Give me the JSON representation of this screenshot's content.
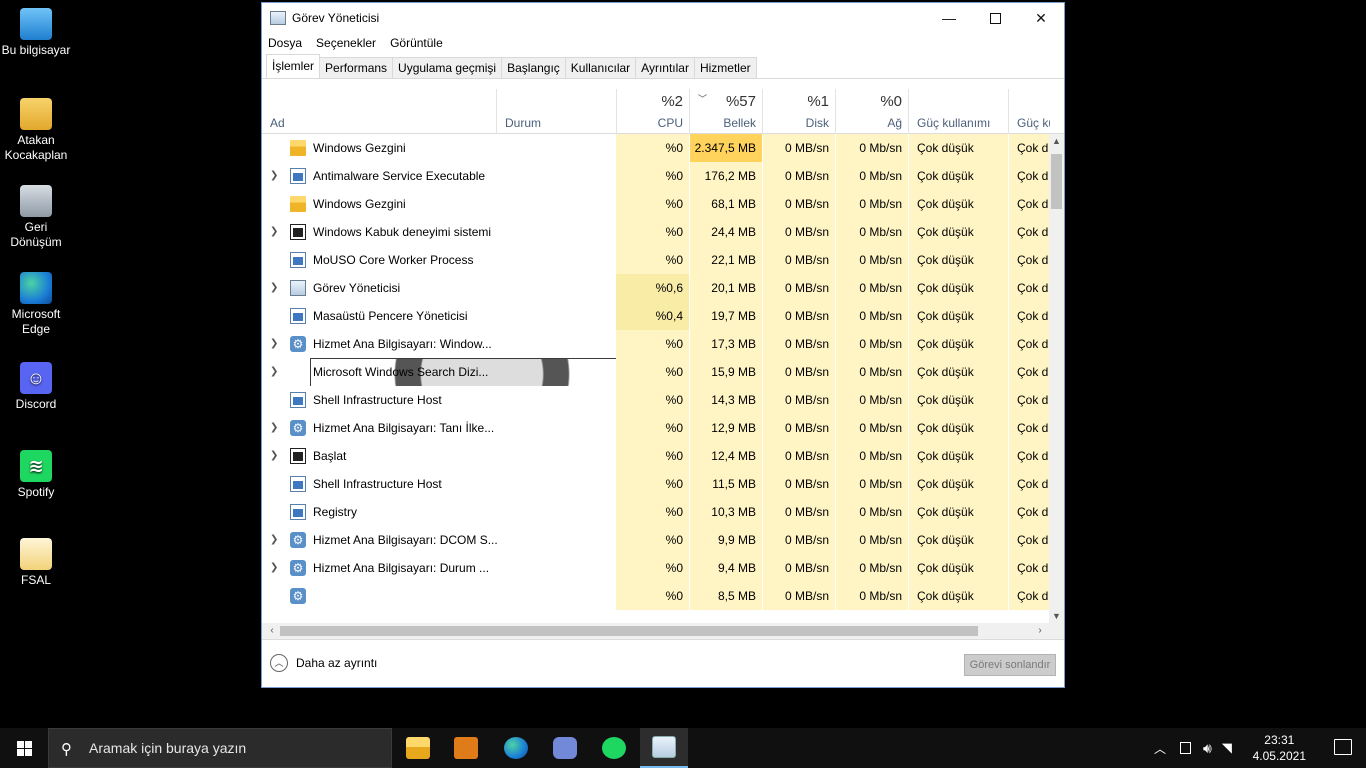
{
  "desktop": {
    "icons": [
      {
        "label": "Bu bilgisayar",
        "icon": "this-pc-icon"
      },
      {
        "label": "Atakan Kocakaplan",
        "icon": "user-folder-icon"
      },
      {
        "label": "Geri Dönüşüm",
        "icon": "recycle-bin-icon"
      },
      {
        "label": "Microsoft Edge",
        "icon": "edge-icon"
      },
      {
        "label": "Discord",
        "icon": "discord-icon"
      },
      {
        "label": "Spotify",
        "icon": "spotify-icon"
      },
      {
        "label": "FSAL",
        "icon": "file-icon"
      }
    ]
  },
  "window": {
    "title": "Görev Yöneticisi",
    "menu": [
      "Dosya",
      "Seçenekler",
      "Görüntüle"
    ],
    "tabs": [
      "İşlemler",
      "Performans",
      "Uygulama geçmişi",
      "Başlangıç",
      "Kullanıcılar",
      "Ayrıntılar",
      "Hizmetler"
    ],
    "active_tab": "İşlemler",
    "columns": {
      "name": "Ad",
      "status": "Durum",
      "cpu_pct": "%2",
      "cpu": "CPU",
      "mem_pct": "%57",
      "mem": "Bellek",
      "disk_pct": "%1",
      "disk": "Disk",
      "net_pct": "%0",
      "net": "Ağ",
      "power": "Güç kullanımı",
      "power_trend": "Güç kulla"
    },
    "rows": [
      {
        "name": "Windows Gezgini",
        "icon": "folder",
        "expand": false,
        "cpu": "%0",
        "mem": "2.347,5 MB",
        "disk": "0 MB/sn",
        "net": "0 Mb/sn",
        "power": "Çok düşük",
        "power2": "Çok dü"
      },
      {
        "name": "Antimalware Service Executable",
        "icon": "blue",
        "expand": true,
        "cpu": "%0",
        "mem": "176,2 MB",
        "disk": "0 MB/sn",
        "net": "0 Mb/sn",
        "power": "Çok düşük",
        "power2": "Çok dü"
      },
      {
        "name": "Windows Gezgini",
        "icon": "folder",
        "expand": false,
        "cpu": "%0",
        "mem": "68,1 MB",
        "disk": "0 MB/sn",
        "net": "0 Mb/sn",
        "power": "Çok düşük",
        "power2": "Çok dü"
      },
      {
        "name": "Windows Kabuk deneyimi sistemi",
        "icon": "dark",
        "expand": true,
        "cpu": "%0",
        "mem": "24,4 MB",
        "disk": "0 MB/sn",
        "net": "0 Mb/sn",
        "power": "Çok düşük",
        "power2": "Çok dü"
      },
      {
        "name": "MoUSO Core Worker Process",
        "icon": "blue",
        "expand": false,
        "cpu": "%0",
        "mem": "22,1 MB",
        "disk": "0 MB/sn",
        "net": "0 Mb/sn",
        "power": "Çok düşük",
        "power2": "Çok dü"
      },
      {
        "name": "Görev Yöneticisi",
        "icon": "tm",
        "expand": true,
        "cpu": "%0,6",
        "mem": "20,1 MB",
        "disk": "0 MB/sn",
        "net": "0 Mb/sn",
        "power": "Çok düşük",
        "power2": "Çok dü"
      },
      {
        "name": "Masaüstü Pencere Yöneticisi",
        "icon": "blue",
        "expand": false,
        "cpu": "%0,4",
        "mem": "19,7 MB",
        "disk": "0 MB/sn",
        "net": "0 Mb/sn",
        "power": "Çok düşük",
        "power2": "Çok dü"
      },
      {
        "name": "Hizmet Ana Bilgisayarı: Window...",
        "icon": "gear",
        "expand": true,
        "cpu": "%0",
        "mem": "17,3 MB",
        "disk": "0 MB/sn",
        "net": "0 Mb/sn",
        "power": "Çok düşük",
        "power2": "Çok dü"
      },
      {
        "name": "Microsoft Windows Search Dizi...",
        "icon": "search",
        "expand": true,
        "cpu": "%0",
        "mem": "15,9 MB",
        "disk": "0 MB/sn",
        "net": "0 Mb/sn",
        "power": "Çok düşük",
        "power2": "Çok dü"
      },
      {
        "name": "Shell Infrastructure Host",
        "icon": "blue",
        "expand": false,
        "cpu": "%0",
        "mem": "14,3 MB",
        "disk": "0 MB/sn",
        "net": "0 Mb/sn",
        "power": "Çok düşük",
        "power2": "Çok dü"
      },
      {
        "name": "Hizmet Ana Bilgisayarı: Tanı İlke...",
        "icon": "gear",
        "expand": true,
        "cpu": "%0",
        "mem": "12,9 MB",
        "disk": "0 MB/sn",
        "net": "0 Mb/sn",
        "power": "Çok düşük",
        "power2": "Çok dü"
      },
      {
        "name": "Başlat",
        "icon": "dark",
        "expand": true,
        "cpu": "%0",
        "mem": "12,4 MB",
        "disk": "0 MB/sn",
        "net": "0 Mb/sn",
        "power": "Çok düşük",
        "power2": "Çok dü"
      },
      {
        "name": "Shell Infrastructure Host",
        "icon": "blue",
        "expand": false,
        "cpu": "%0",
        "mem": "11,5 MB",
        "disk": "0 MB/sn",
        "net": "0 Mb/sn",
        "power": "Çok düşük",
        "power2": "Çok dü"
      },
      {
        "name": "Registry",
        "icon": "blue",
        "expand": false,
        "cpu": "%0",
        "mem": "10,3 MB",
        "disk": "0 MB/sn",
        "net": "0 Mb/sn",
        "power": "Çok düşük",
        "power2": "Çok dü"
      },
      {
        "name": "Hizmet Ana Bilgisayarı: DCOM S...",
        "icon": "gear",
        "expand": true,
        "cpu": "%0",
        "mem": "9,9 MB",
        "disk": "0 MB/sn",
        "net": "0 Mb/sn",
        "power": "Çok düşük",
        "power2": "Çok dü"
      },
      {
        "name": "Hizmet Ana Bilgisayarı: Durum ...",
        "icon": "gear",
        "expand": true,
        "cpu": "%0",
        "mem": "9,4 MB",
        "disk": "0 MB/sn",
        "net": "0 Mb/sn",
        "power": "Çok düşük",
        "power2": "Çok dü"
      },
      {
        "name": "",
        "icon": "gear",
        "expand": false,
        "cpu": "%0",
        "mem": "8,5 MB",
        "disk": "0 MB/sn",
        "net": "0 Mb/sn",
        "power": "Çok düşük",
        "power2": "Çok dü"
      }
    ],
    "footer": {
      "less_details": "Daha az ayrıntı",
      "end_task": "Görevi sonlandır"
    }
  },
  "taskbar": {
    "search_placeholder": "Aramak için buraya yazın",
    "apps": [
      "file-explorer-icon",
      "media-player-icon",
      "edge-icon",
      "discord-icon",
      "spotify-icon",
      "task-manager-icon"
    ],
    "time": "23:31",
    "date": "4.05.2021"
  }
}
